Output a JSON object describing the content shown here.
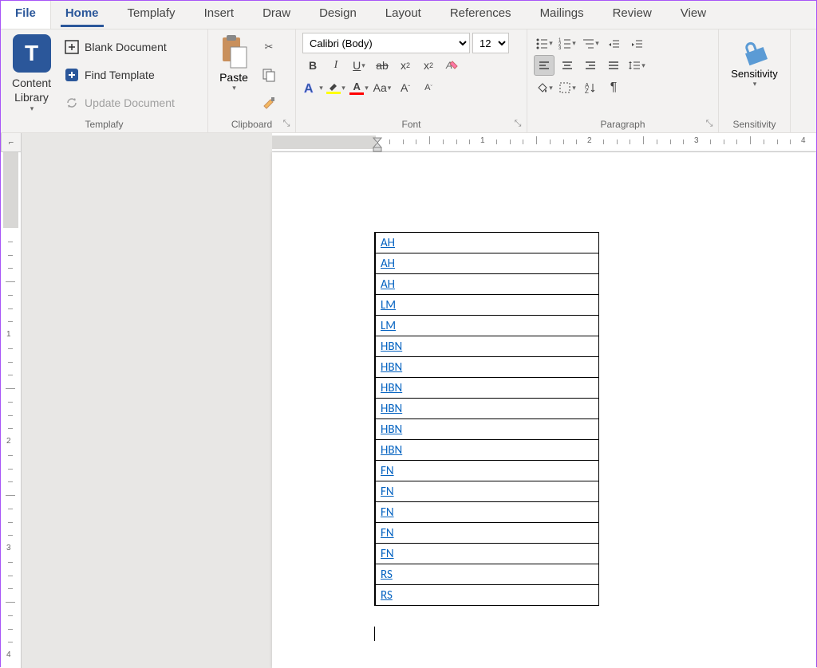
{
  "tabs": {
    "file": "File",
    "home": "Home",
    "templafy": "Templafy",
    "insert": "Insert",
    "draw": "Draw",
    "design": "Design",
    "layout": "Layout",
    "references": "References",
    "mailings": "Mailings",
    "review": "Review",
    "view": "View"
  },
  "templafy_group": {
    "content_library": "Content\nLibrary",
    "blank_doc": "Blank Document",
    "find_template": "Find Template",
    "update_doc": "Update Document",
    "label": "Templafy"
  },
  "clipboard_group": {
    "paste": "Paste",
    "label": "Clipboard"
  },
  "font_group": {
    "font_name": "Calibri (Body)",
    "font_size": "12",
    "label": "Font"
  },
  "paragraph_group": {
    "label": "Paragraph"
  },
  "sensitivity_group": {
    "btn": "Sensitivity",
    "label": "Sensitivity"
  },
  "ruler": {
    "marks": [
      "1",
      "2",
      "3",
      "4"
    ]
  },
  "doc_cells": [
    "AH",
    "AH",
    "AH",
    "LM",
    "LM",
    "HBN",
    "HBN",
    "HBN",
    "HBN",
    "HBN",
    "HBN",
    "FN",
    "FN",
    "FN",
    "FN",
    "FN",
    "RS",
    "RS"
  ]
}
